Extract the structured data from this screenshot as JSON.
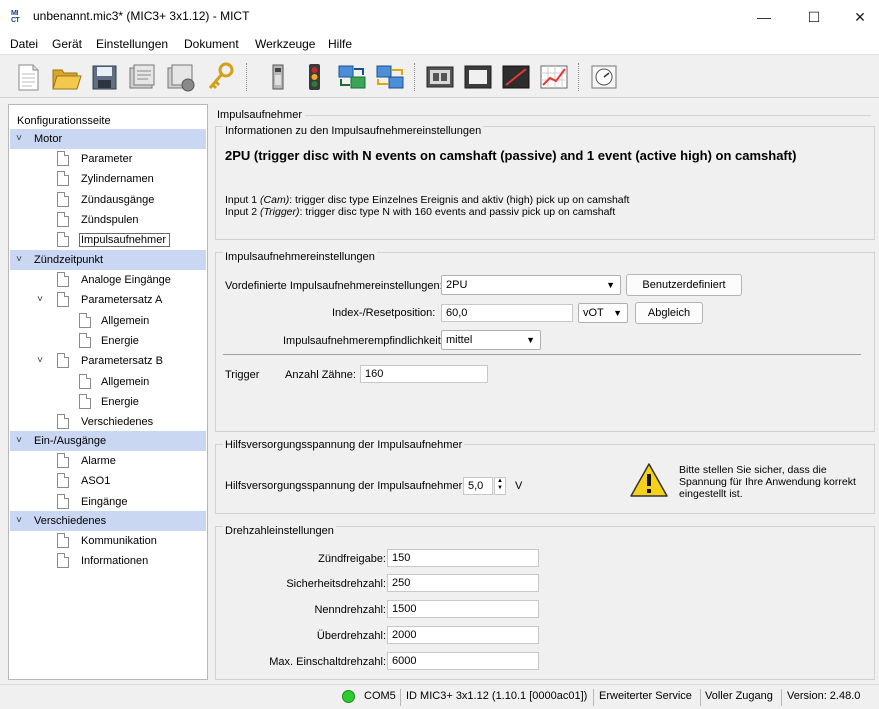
{
  "window": {
    "title": "unbenannt.mic3* (MIC3+ 3x1.12) - MICT",
    "logo_top": "MI",
    "logo_bottom": "CT",
    "minimize": "—",
    "maximize": "☐",
    "close": "✕"
  },
  "menu": {
    "items": [
      "Datei",
      "Gerät",
      "Einstellungen",
      "Dokument",
      "Werkzeuge",
      "Hilfe"
    ]
  },
  "toolbar": {
    "buttons": [
      "new-document-icon",
      "open-folder-icon",
      "save-icon",
      "read-device-icon",
      "write-device-icon",
      "key-icon",
      "device-icon",
      "traffic-light-icon",
      "transfer-icon",
      "network-transfer-icon",
      "monitor-icon",
      "display-icon",
      "oscilloscope-icon",
      "chart-icon",
      "gauge-icon"
    ]
  },
  "tree": {
    "header": "Konfigurationsseite",
    "rows": [
      {
        "label": "Motor",
        "type": "category",
        "caret": "˅"
      },
      {
        "label": "Parameter",
        "type": "page"
      },
      {
        "label": "Zylindernamen",
        "type": "page"
      },
      {
        "label": "Zündausgänge",
        "type": "page"
      },
      {
        "label": "Zündspulen",
        "type": "page"
      },
      {
        "label": "Impulsaufnehmer",
        "type": "page",
        "selected": true
      },
      {
        "label": "Zündzeitpunkt",
        "type": "category",
        "caret": "˅"
      },
      {
        "label": "Analoge Eingänge",
        "type": "page"
      },
      {
        "label": "Parametersatz A",
        "type": "folder",
        "caret": "˅"
      },
      {
        "label": "Allgemein",
        "type": "subpage"
      },
      {
        "label": "Energie",
        "type": "subpage"
      },
      {
        "label": "Parametersatz B",
        "type": "folder",
        "caret": "˅"
      },
      {
        "label": "Allgemein",
        "type": "subpage"
      },
      {
        "label": "Energie",
        "type": "subpage"
      },
      {
        "label": "Verschiedenes",
        "type": "page"
      },
      {
        "label": "Ein-/Ausgänge",
        "type": "category",
        "caret": "˅"
      },
      {
        "label": "Alarme",
        "type": "page"
      },
      {
        "label": "ASO1",
        "type": "page"
      },
      {
        "label": "Eingänge",
        "type": "page"
      },
      {
        "label": "Verschiedenes",
        "type": "category",
        "caret": "˅"
      },
      {
        "label": "Kommunikation",
        "type": "page"
      },
      {
        "label": "Informationen",
        "type": "page"
      }
    ]
  },
  "content": {
    "page_title": "Impulsaufnehmer",
    "info": {
      "group_title": "Informationen zu den Impulsaufnehmereinstellungen",
      "heading": "2PU (trigger disc with N events on camshaft (passive) and 1 event (active high) on camshaft)",
      "input1_prefix": "Input 1 ",
      "input1_em": "(Cam)",
      "input1_rest": ": trigger disc type Einzelnes Ereignis and aktiv (high) pick up on camshaft",
      "input2_prefix": "Input 2 ",
      "input2_em": "(Trigger)",
      "input2_rest": ": trigger disc type N with 160 events and passiv pick up on camshaft"
    },
    "settings": {
      "group_title": "Impulsaufnehmereinstellungen",
      "preset_label": "Vordefinierte Impulsaufnehmereinstellungen:",
      "preset_value": "2PU",
      "custom_button": "Benutzerdefiniert",
      "index_label": "Index-/Resetposition:",
      "index_value": "60,0",
      "index_unit": "vOT",
      "adjust_button": "Abgleich",
      "sensitivity_label": "Impulsaufnehmerempfindlichkeit:",
      "sensitivity_value": "mittel",
      "trigger_label": "Trigger",
      "teeth_label": "Anzahl Zähne:",
      "teeth_value": "160"
    },
    "supply": {
      "group_title": "Hilfsversorgungsspannung der Impulsaufnehmer",
      "voltage_label": "Hilfsversorgungsspannung der Impulsaufnehmer:",
      "voltage_value": "5,0",
      "voltage_unit": "V",
      "warning_line1": "Bitte stellen Sie sicher, dass die",
      "warning_line2": "Spannung für Ihre Anwendung korrekt",
      "warning_line3": "eingestellt ist."
    },
    "speed": {
      "group_title": "Drehzahleinstellungen",
      "rows": [
        {
          "label": "Zündfreigabe:",
          "value": "150"
        },
        {
          "label": "Sicherheitsdrehzahl:",
          "value": "250"
        },
        {
          "label": "Nenndrehzahl:",
          "value": "1500"
        },
        {
          "label": "Überdrehzahl:",
          "value": "2000"
        },
        {
          "label": "Max. Einschaltdrehzahl:",
          "value": "6000"
        }
      ]
    }
  },
  "status": {
    "port": "COM5",
    "device_id": "ID MIC3+ 3x1.12 (1.10.1 [0000ac01])",
    "service": "Erweiterter Service",
    "access": "Voller Zugang",
    "version": "Version: 2.48.0",
    "led_color": "#2ecc2e"
  }
}
